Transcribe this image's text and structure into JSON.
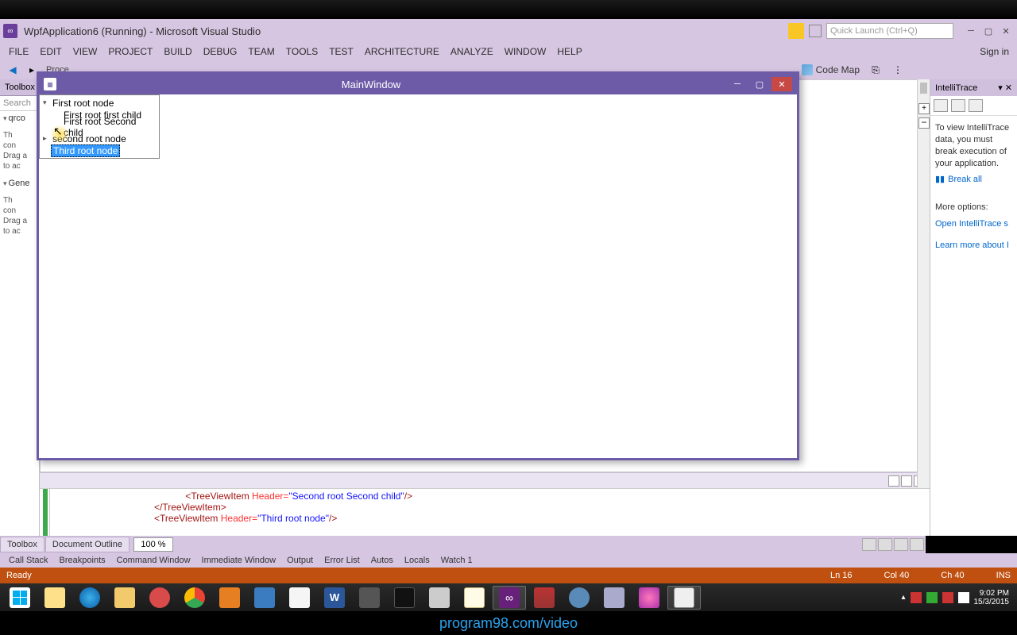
{
  "vs": {
    "window_title": "WpfApplication6 (Running) - Microsoft Visual Studio",
    "quick_launch_placeholder": "Quick Launch (Ctrl+Q)",
    "sign_in": "Sign in",
    "menus": [
      "FILE",
      "EDIT",
      "VIEW",
      "PROJECT",
      "BUILD",
      "DEBUG",
      "TEAM",
      "TOOLS",
      "TEST",
      "ARCHITECTURE",
      "ANALYZE",
      "WINDOW",
      "HELP"
    ],
    "code_map_label": "Code Map",
    "process_label": "Proce"
  },
  "toolbox": {
    "tab": "Toolbox",
    "search": "Search",
    "group1": "qrco",
    "empty1": "Th\ncon\nDrag a\nto ac",
    "group2": "Gene",
    "empty2": "Th\ncon\nDrag a\nto ac",
    "bottom_tab1": "Toolbox",
    "bottom_tab2": "Document Outline",
    "zoom": "100 %"
  },
  "intellitrace": {
    "header": "IntelliTrace",
    "body": "To view IntelliTrace data, you must break execution of your application.",
    "break_all": "Break all",
    "more_options": "More options:",
    "open_settings": "Open IntelliTrace s",
    "learn_more": "Learn more about I"
  },
  "app_window": {
    "title": "MainWindow",
    "tree": {
      "root1": "First root node",
      "root1_child1": "First root first child",
      "root1_child2": "First root Second child",
      "root2": "second root node",
      "root3": "Third root node"
    }
  },
  "code": {
    "l1a": "<TreeViewItem",
    "l1b": " Header=",
    "l1c": "\"Second root Second child\"",
    "l1d": "/>",
    "l2a": "</TreeViewItem>",
    "l3a": "<TreeViewItem",
    "l3b": " Header=",
    "l3c": "\"Third root node\"",
    "l3d": "/>"
  },
  "debug_tabs": [
    "Call Stack",
    "Breakpoints",
    "Command Window",
    "Immediate Window",
    "Output",
    "Error List",
    "Autos",
    "Locals",
    "Watch 1"
  ],
  "status": {
    "ready": "Ready",
    "ln": "Ln 16",
    "col": "Col 40",
    "ch": "Ch 40",
    "ins": "INS"
  },
  "tray": {
    "time": "9:02 PM",
    "date": "15/3/2015"
  },
  "watermark": "program98.com/video"
}
